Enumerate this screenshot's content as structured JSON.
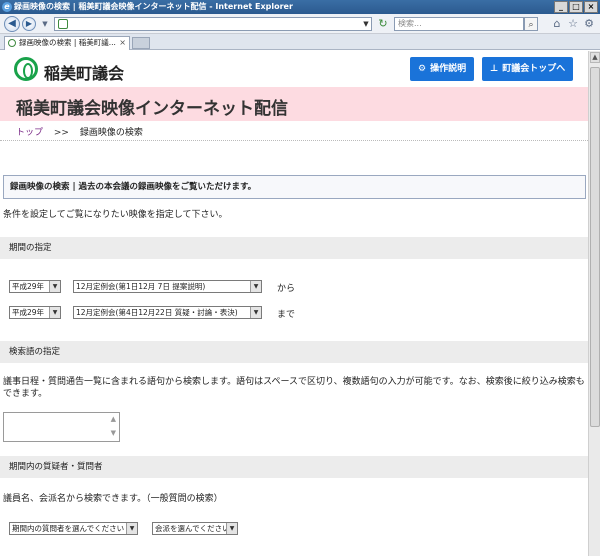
{
  "window": {
    "title": "録画映像の検索 | 稲美町議会映像インターネット配信 - Internet Explorer"
  },
  "address": {
    "value": "",
    "search_placeholder": "検索..."
  },
  "tab": {
    "label": "録画映像の検索 | 稲美町議...",
    "close": "×"
  },
  "header": {
    "site_name": "稲美町議会",
    "buttons": [
      {
        "label": "操作説明",
        "icon": "gear-icon"
      },
      {
        "label": "町議会トップへ",
        "icon": "sitemap-icon"
      }
    ]
  },
  "banner": {
    "title": "稲美町議会映像インターネット配信"
  },
  "breadcrumb": {
    "home": "トップ",
    "separator": ">>",
    "current": "録画映像の検索"
  },
  "intro": {
    "box": "録画映像の検索 | 過去の本会議の録画映像をご覧いただけます。",
    "lead": "条件を設定してご覧になりたい映像を指定して下さい。"
  },
  "period": {
    "heading": "期間の指定",
    "from": {
      "year": "平成29年",
      "meeting": "12月定例会(第1日12月 7日 提案説明)",
      "suffix": "から"
    },
    "to": {
      "year": "平成29年",
      "meeting": "12月定例会(第4日12月22日 質疑・討論・表決)",
      "suffix": "まで"
    }
  },
  "keyword": {
    "heading": "検索語の指定",
    "note": "議事日程・質問通告一覧に含まれる語句から検索します。語句はスペースで区切り、複数語句の入力が可能です。なお、検索後に絞り込み検索もできます。",
    "value": ""
  },
  "questioner": {
    "heading": "期間内の質疑者・質問者",
    "note": "議員名、会派名から検索できます。（一般質問の検索）",
    "member_select": "期間内の質問者を選んでください",
    "party_select": "会派を選んでください"
  }
}
